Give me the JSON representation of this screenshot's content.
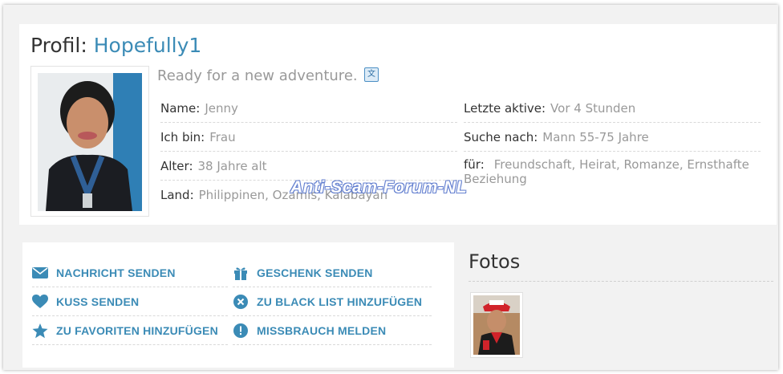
{
  "profile": {
    "title_prefix": "Profil:",
    "username": "Hopefully1",
    "tagline": "Ready for a new adventure.",
    "translate_icon": "translate-icon",
    "fields_left": [
      {
        "label": "Name:",
        "value": "Jenny"
      },
      {
        "label": "Ich bin:",
        "value": "Frau"
      },
      {
        "label": "Alter:",
        "value": "38 Jahre alt"
      },
      {
        "label": "Land:",
        "value": "Philippinen, Ozamis, Kalabayan"
      }
    ],
    "fields_right": [
      {
        "label": "Letzte aktive:",
        "value": "Vor 4 Stunden"
      },
      {
        "label": "Suche nach:",
        "value": "Mann 55-75 Jahre"
      },
      {
        "label": "für:",
        "value": "Freundschaft, Heirat, Romanze, Ernsthafte Beziehung"
      }
    ]
  },
  "actions": {
    "left": [
      {
        "label": "NACHRICHT SENDEN",
        "icon": "envelope-icon"
      },
      {
        "label": "KUSS SENDEN",
        "icon": "heart-icon"
      },
      {
        "label": "ZU FAVORITEN HINZUFÜGEN",
        "icon": "star-icon"
      }
    ],
    "right": [
      {
        "label": "GESCHENK SENDEN",
        "icon": "gift-icon"
      },
      {
        "label": "ZU BLACK LIST HINZUFÜGEN",
        "icon": "block-icon"
      },
      {
        "label": "MISSBRAUCH MELDEN",
        "icon": "alert-icon"
      }
    ]
  },
  "photos": {
    "title": "Fotos"
  },
  "watermark": "Anti-Scam-Forum-NL",
  "colors": {
    "accent": "#3b8bb6",
    "text": "#333333",
    "muted": "#999999",
    "background": "#f2f2f2"
  }
}
